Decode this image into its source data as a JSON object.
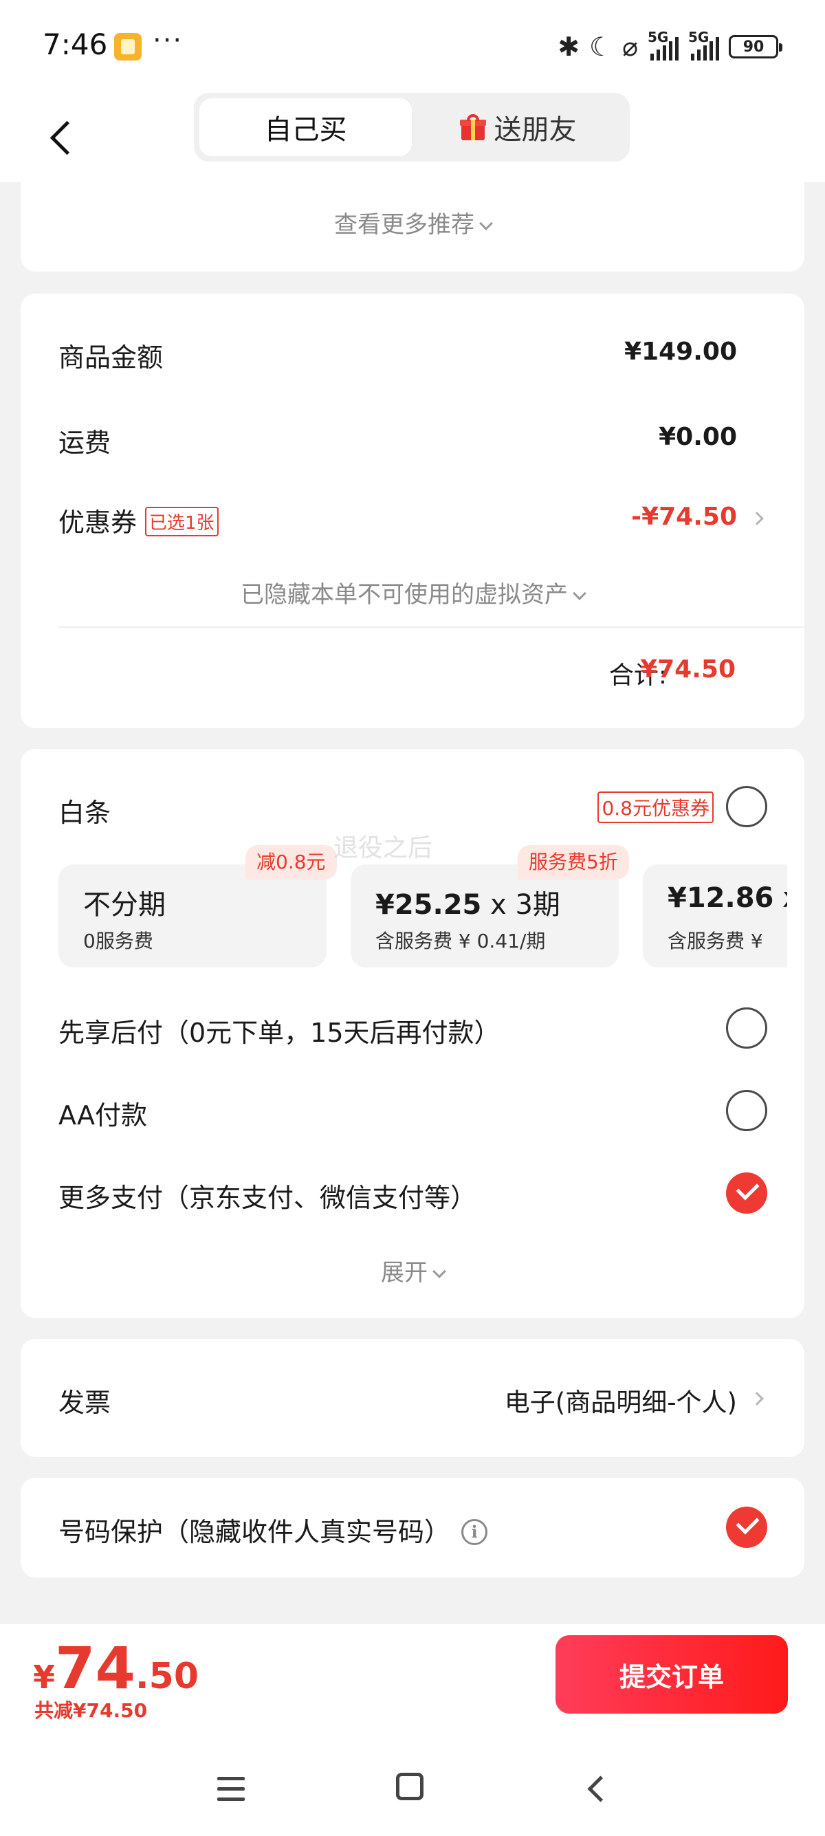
{
  "status_bar": {
    "time": "7:46",
    "more": "···",
    "battery": "90",
    "network1": "5G",
    "network2": "5G"
  },
  "nav": {
    "tabs": [
      {
        "label": "自己买",
        "active": true
      },
      {
        "label": "送朋友",
        "active": false
      }
    ]
  },
  "recommend": {
    "see_more": "查看更多推荐"
  },
  "summary": {
    "goods_label": "商品金额",
    "goods_value": "¥149.00",
    "shipping_label": "运费",
    "shipping_value": "¥0.00",
    "coupon_label": "优惠券",
    "coupon_tag": "已选1张",
    "coupon_value": "-¥74.50",
    "hidden_assets": "已隐藏本单不可使用的虚拟资产",
    "total_label": "合计:",
    "total_value": "¥74.50"
  },
  "payment": {
    "baitiao_label": "白条",
    "baitiao_coupon": "0.8元优惠券",
    "installments": [
      {
        "title": "不分期",
        "sub": "0服务费",
        "badge": "减0.8元"
      },
      {
        "amount": "¥25.25",
        "times": "x",
        "periods": "3期",
        "sub": "含服务费 ¥ 0.41/期",
        "badge": "服务费5折"
      },
      {
        "amount": "¥12.86",
        "times": "x",
        "periods": "",
        "sub": "含服务费 ¥",
        "badge": ""
      }
    ],
    "watermark": "退役之后",
    "options": [
      {
        "label": "先享后付（0元下单，15天后再付款）",
        "checked": false
      },
      {
        "label": "AA付款",
        "checked": false
      },
      {
        "label": "更多支付（京东支付、微信支付等）",
        "checked": true
      }
    ],
    "expand": "展开"
  },
  "invoice": {
    "label": "发票",
    "value": "电子(商品明细-个人)"
  },
  "privacy": {
    "label": "号码保护（隐藏收件人真实号码）",
    "checked": true
  },
  "bottom": {
    "currency": "¥",
    "price_int": "74",
    "price_dec": ".50",
    "saved": "共减¥74.50",
    "submit": "提交订单"
  },
  "colors": {
    "accent": "#e63a2e",
    "submit_gradient_start": "#ff3d5a",
    "submit_gradient_end": "#ff1a1a"
  }
}
